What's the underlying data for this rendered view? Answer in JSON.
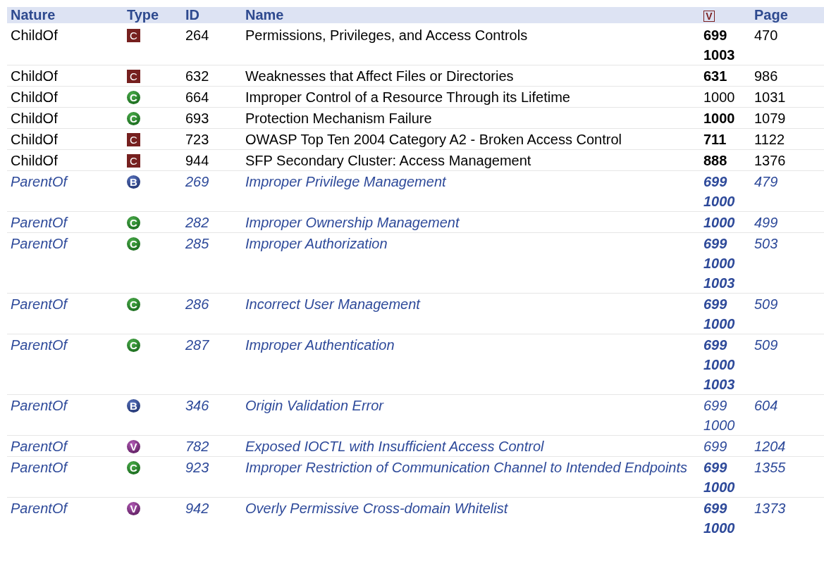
{
  "table": {
    "columns": [
      {
        "kind": "text",
        "label": "Nature"
      },
      {
        "kind": "text",
        "label": "Type"
      },
      {
        "kind": "text",
        "label": "ID"
      },
      {
        "kind": "text",
        "label": "Name"
      },
      {
        "kind": "icon",
        "label": "V"
      },
      {
        "kind": "text",
        "label": "Page"
      }
    ],
    "rows": [
      {
        "nature": "ChildOf",
        "link": false,
        "type": {
          "kind": "category",
          "letter": "C"
        },
        "id": "264",
        "name": "Permissions, Privileges, and Access Controls",
        "views": [
          {
            "text": "699",
            "bold": true
          },
          {
            "text": "1003",
            "bold": true
          }
        ],
        "page": "470"
      },
      {
        "nature": "ChildOf",
        "link": false,
        "type": {
          "kind": "category",
          "letter": "C"
        },
        "id": "632",
        "name": "Weaknesses that Affect Files or Directories",
        "views": [
          {
            "text": "631",
            "bold": true
          }
        ],
        "page": "986"
      },
      {
        "nature": "ChildOf",
        "link": false,
        "type": {
          "kind": "class",
          "letter": "C"
        },
        "id": "664",
        "name": "Improper Control of a Resource Through its Lifetime",
        "views": [
          {
            "text": "1000",
            "bold": false
          }
        ],
        "page": "1031"
      },
      {
        "nature": "ChildOf",
        "link": false,
        "type": {
          "kind": "class",
          "letter": "C"
        },
        "id": "693",
        "name": "Protection Mechanism Failure",
        "views": [
          {
            "text": "1000",
            "bold": true
          }
        ],
        "page": "1079"
      },
      {
        "nature": "ChildOf",
        "link": false,
        "type": {
          "kind": "category",
          "letter": "C"
        },
        "id": "723",
        "name": "OWASP Top Ten 2004 Category A2 - Broken Access Control",
        "views": [
          {
            "text": "711",
            "bold": true
          }
        ],
        "page": "1122"
      },
      {
        "nature": "ChildOf",
        "link": false,
        "type": {
          "kind": "category",
          "letter": "C"
        },
        "id": "944",
        "name": "SFP Secondary Cluster: Access Management",
        "views": [
          {
            "text": "888",
            "bold": true
          }
        ],
        "page": "1376"
      },
      {
        "nature": "ParentOf",
        "link": true,
        "type": {
          "kind": "base",
          "letter": "B"
        },
        "id": "269",
        "name": "Improper Privilege Management",
        "views": [
          {
            "text": "699",
            "bold": true
          },
          {
            "text": "1000",
            "bold": true
          }
        ],
        "page": "479"
      },
      {
        "nature": "ParentOf",
        "link": true,
        "type": {
          "kind": "class",
          "letter": "C"
        },
        "id": "282",
        "name": "Improper Ownership Management",
        "views": [
          {
            "text": "1000",
            "bold": true
          }
        ],
        "page": "499"
      },
      {
        "nature": "ParentOf",
        "link": true,
        "type": {
          "kind": "class",
          "letter": "C"
        },
        "id": "285",
        "name": "Improper Authorization",
        "views": [
          {
            "text": "699",
            "bold": true
          },
          {
            "text": "1000",
            "bold": true
          },
          {
            "text": "1003",
            "bold": true
          }
        ],
        "page": "503"
      },
      {
        "nature": "ParentOf",
        "link": true,
        "type": {
          "kind": "class",
          "letter": "C"
        },
        "id": "286",
        "name": "Incorrect User Management",
        "views": [
          {
            "text": "699",
            "bold": true
          },
          {
            "text": "1000",
            "bold": true
          }
        ],
        "page": "509"
      },
      {
        "nature": "ParentOf",
        "link": true,
        "type": {
          "kind": "class",
          "letter": "C"
        },
        "id": "287",
        "name": "Improper Authentication",
        "views": [
          {
            "text": "699",
            "bold": true
          },
          {
            "text": "1000",
            "bold": true
          },
          {
            "text": "1003",
            "bold": true
          }
        ],
        "page": "509"
      },
      {
        "nature": "ParentOf",
        "link": true,
        "type": {
          "kind": "base",
          "letter": "B"
        },
        "id": "346",
        "name": "Origin Validation Error",
        "views": [
          {
            "text": "699",
            "bold": false
          },
          {
            "text": "1000",
            "bold": false
          }
        ],
        "page": "604"
      },
      {
        "nature": "ParentOf",
        "link": true,
        "type": {
          "kind": "variant",
          "letter": "V"
        },
        "id": "782",
        "name": "Exposed IOCTL with Insufficient Access Control",
        "views": [
          {
            "text": "699",
            "bold": false
          }
        ],
        "page": "1204"
      },
      {
        "nature": "ParentOf",
        "link": true,
        "type": {
          "kind": "class",
          "letter": "C"
        },
        "id": "923",
        "name": "Improper Restriction of Communication Channel to Intended Endpoints",
        "views": [
          {
            "text": "699",
            "bold": true
          },
          {
            "text": "1000",
            "bold": true
          }
        ],
        "page": "1355"
      },
      {
        "nature": "ParentOf",
        "link": true,
        "type": {
          "kind": "variant",
          "letter": "V"
        },
        "id": "942",
        "name": "Overly Permissive Cross-domain Whitelist",
        "views": [
          {
            "text": "699",
            "bold": true
          },
          {
            "text": "1000",
            "bold": true
          }
        ],
        "page": "1373"
      }
    ]
  }
}
